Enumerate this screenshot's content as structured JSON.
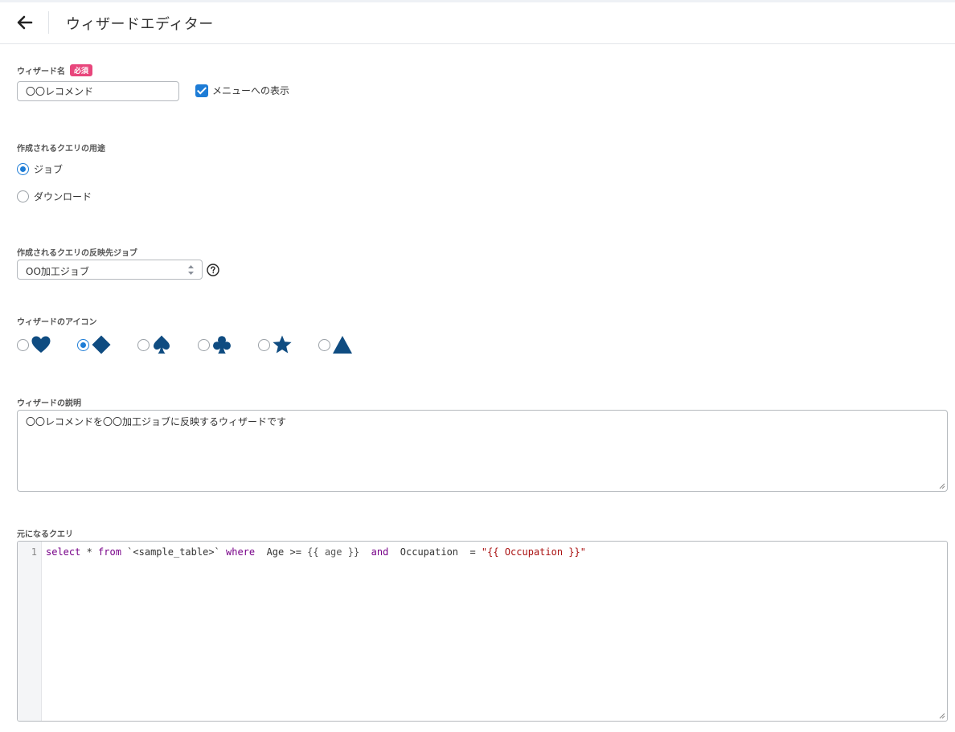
{
  "header": {
    "title": "ウィザードエディター"
  },
  "wizard_name": {
    "label": "ウィザード名",
    "required_badge": "必須",
    "value": "〇〇レコメンド",
    "menu_checkbox": {
      "label": "メニューへの表示",
      "checked": true
    }
  },
  "purpose": {
    "label": "作成されるクエリの用途",
    "options": [
      {
        "label": "ジョブ",
        "selected": true
      },
      {
        "label": "ダウンロード",
        "selected": false
      }
    ]
  },
  "target_job": {
    "label": "作成されるクエリの反映先ジョブ",
    "selected": "OO加工ジョブ"
  },
  "wizard_icon": {
    "label": "ウィザードのアイコン",
    "options": [
      {
        "icon": "heart-icon",
        "selected": false
      },
      {
        "icon": "diamond-icon",
        "selected": true
      },
      {
        "icon": "spade-icon",
        "selected": false
      },
      {
        "icon": "club-icon",
        "selected": false
      },
      {
        "icon": "star-icon",
        "selected": false
      },
      {
        "icon": "triangle-icon",
        "selected": false
      }
    ],
    "color": "#0f4c81"
  },
  "description": {
    "label": "ウィザードの説明",
    "value": "〇〇レコメンドを〇〇加工ジョブに反映するウィザードです"
  },
  "base_query": {
    "label": "元になるクエリ",
    "line_number": "1",
    "tokens": {
      "t1": "select",
      "t2": " * ",
      "t3": "from",
      "t4": " `<sample_table>` ",
      "t5": "where",
      "t6": "  Age >= ",
      "t7": "{{ age }}",
      "t8": "  ",
      "t9": "and",
      "t10": "  Occupation  = ",
      "t11": "\"{{ Occupation }}\""
    }
  },
  "colors": {
    "accent": "#1d7cd6",
    "badge": "#e8467c",
    "icon": "#0f4c81"
  }
}
